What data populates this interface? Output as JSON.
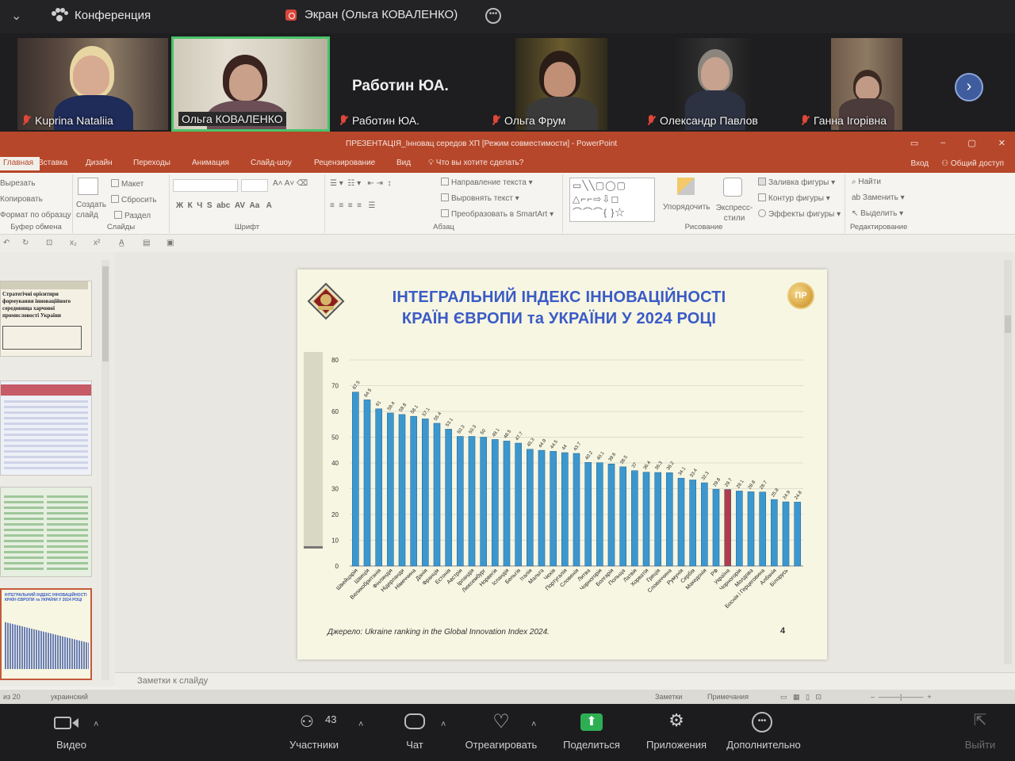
{
  "zoom": {
    "meeting_title": "Конференция",
    "screen_share_label": "Экран (Ольга КОВАЛЕНКО)",
    "participants": [
      {
        "name": "Kuprina Nataliia"
      },
      {
        "name": "Ольга КОВАЛЕНКО"
      },
      {
        "name": "Работин ЮА.",
        "big_name": "Работин ЮА."
      },
      {
        "name": "Ольга Фрум"
      },
      {
        "name": "Олександр Павлов"
      },
      {
        "name": "Ганна Ігорівна"
      }
    ],
    "toolbar": {
      "video": "Видео",
      "participants": "Участники",
      "participants_count": "43",
      "chat": "Чат",
      "react": "Отреагировать",
      "share": "Поделиться",
      "apps": "Приложения",
      "more": "Дополнительно",
      "leave": "Выйти"
    },
    "accent_share": "#2eae53",
    "accent_name_border": "#49c36a"
  },
  "powerpoint": {
    "window_title": "ПРЕЗЕНТАЦІЯ_Інновац середов ХП [Режим совместимости] - PowerPoint",
    "tabs": [
      "Главная",
      "Вставка",
      "Дизайн",
      "Переходы",
      "Анимация",
      "Слайд-шоу",
      "Рецензирование",
      "Вид"
    ],
    "tell_me": "Что вы хотите сделать?",
    "sign_in": "Вход",
    "share": "Общий доступ",
    "ribbon": {
      "clipboard": {
        "cut": "Вырезать",
        "copy": "Копировать",
        "format": "Формат по образцу",
        "label": "Буфер обмена"
      },
      "slides": {
        "new": "Создать слайд",
        "layout": "Макет",
        "reset": "Сбросить",
        "section": "Раздел",
        "label": "Слайды"
      },
      "font": {
        "label": "Шрифт"
      },
      "paragraph": {
        "direction": "Направление текста",
        "align": "Выровнять текст",
        "smartart": "Преобразовать в SmartArt",
        "label": "Абзац"
      },
      "drawing": {
        "arrange": "Упорядочить",
        "quick_styles": "Экспресс-стили",
        "fill": "Заливка фигуры",
        "outline": "Контур фигуры",
        "effects": "Эффекты фигуры",
        "label": "Рисование"
      },
      "editing": {
        "find": "Найти",
        "replace": "Заменить",
        "select": "Выделить",
        "label": "Редактирование"
      }
    },
    "notes_placeholder": "Заметки к слайду",
    "status": {
      "slide": "из 20",
      "language": "украинский",
      "notes": "Заметки",
      "comments": "Примечания"
    },
    "thumb_titles": [
      "Стратегічні орієнтири формування інноваційного середовища харчової промисловості України",
      "",
      "",
      "ІНТЕГРАЛЬНИЙ ІНДЕКС ІННОВАЦІЙНОСТІ КРАЇН ЄВРОПИ та УКРАЇНИ У 2024 РОЦІ"
    ]
  },
  "slide": {
    "title_line1": "ІНТЕГРАЛЬНИЙ ІНДЕКС ІННОВАЦІЙНОСТІ",
    "title_line2": "КРАЇН ЄВРОПИ та УКРАЇНИ У 2024 РОЦІ",
    "source": "Джерело: Ukraine ranking in the Global Innovation Index 2024.",
    "page_number": "4",
    "logo_text": "ПР"
  },
  "chart_data": {
    "type": "bar",
    "title": "ІНТЕГРАЛЬНИЙ ІНДЕКС ІННОВАЦІЙНОСТІ КРАЇН ЄВРОПИ та УКРАЇНИ У 2024 РОЦІ",
    "ylim": [
      0,
      80
    ],
    "yticks": [
      0,
      10,
      20,
      30,
      40,
      50,
      60,
      70,
      80
    ],
    "grid": true,
    "bar_color": "#3c97cf",
    "highlight_color": "#b33a4a",
    "highlight_category": "Україна",
    "categories": [
      "Швейцарія",
      "Швеція",
      "Великобританія",
      "Фінляндія",
      "Нідерланди",
      "Німеччина",
      "Данія",
      "Франція",
      "Естонія",
      "Австрія",
      "Ірландія",
      "Люксембург",
      "Норвегія",
      "Ісландія",
      "Бельгія",
      "Італія",
      "Мальта",
      "Чехія",
      "Португалія",
      "Словенія",
      "Литва",
      "Чорногорія",
      "Болгарія",
      "Польща",
      "Латвія",
      "Хорватія",
      "Греція",
      "Словаччина",
      "Румунія",
      "Сербія",
      "Македонія",
      "РФ",
      "Україна",
      "Чорногорія",
      "Молдова",
      "Боснія і Герцеговина",
      "Албанія",
      "Білорусь"
    ],
    "values": [
      67.5,
      64.5,
      61,
      59.4,
      58.8,
      58.1,
      57.1,
      55.4,
      53.1,
      50.3,
      50.3,
      50,
      49.1,
      48.5,
      47.7,
      45.3,
      44.9,
      44.5,
      44,
      43.7,
      40.2,
      40.1,
      39.6,
      38.5,
      37,
      36.4,
      36.3,
      36.2,
      34.1,
      33.4,
      32.3,
      29.8,
      29.7,
      29.1,
      28.8,
      28.7,
      25.8,
      24.9,
      24.8
    ]
  }
}
